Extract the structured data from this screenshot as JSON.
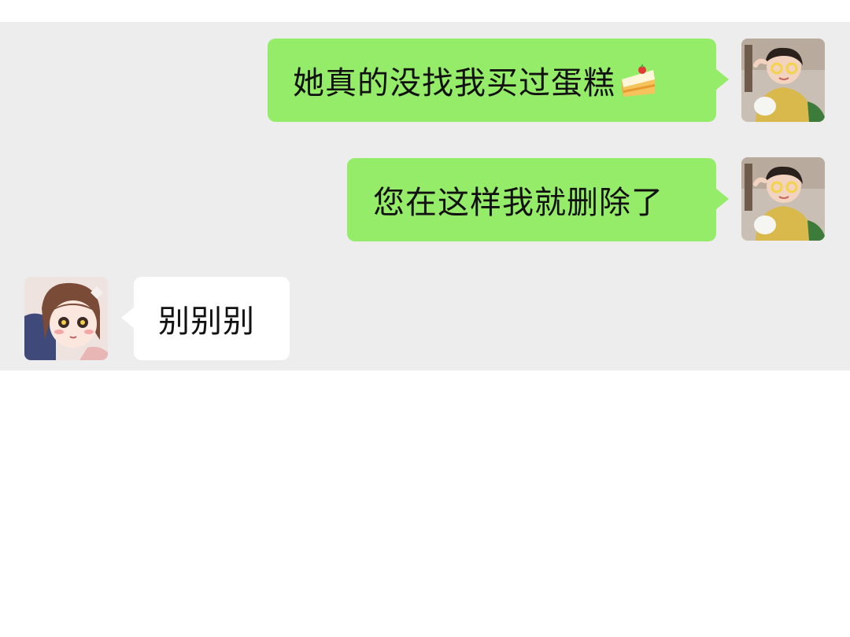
{
  "colors": {
    "chat_background": "#ededed",
    "outgoing_bubble": "#95ec69",
    "incoming_bubble": "#ffffff",
    "page_background": "#ffffff"
  },
  "messages": [
    {
      "direction": "outgoing",
      "text": "她真的没找我买过蛋糕",
      "emoji": "cake-slice-icon"
    },
    {
      "direction": "outgoing",
      "text": "您在这样我就删除了"
    },
    {
      "direction": "incoming",
      "text": "别别别"
    }
  ],
  "avatars": {
    "self": "child-photo-avatar",
    "contact": "anime-girl-avatar"
  }
}
